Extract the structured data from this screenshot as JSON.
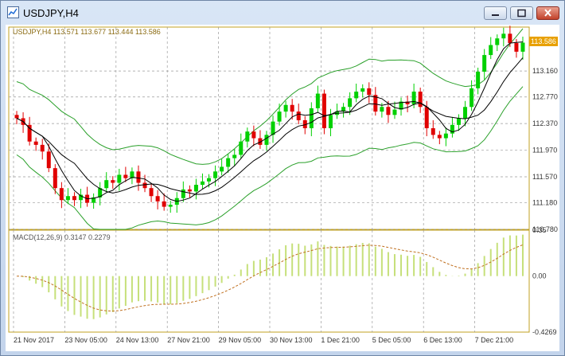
{
  "window": {
    "title": "USDJPY,H4"
  },
  "colors": {
    "bull": "#00d000",
    "bear": "#e00000",
    "grid": "#9a9a9a",
    "frame": "#c0a020",
    "bands": "#2aa02a",
    "ma": "#000000",
    "macd_hist": "#c6e07a",
    "macd_signal": "#c07020",
    "price_box": "#e8a000"
  },
  "chart_data": [
    {
      "type": "candlestick",
      "title": "USDJPY,H4",
      "ohlc_label": "USDJPY,H4  113.571 113.677 113.444 113.586",
      "current_price": "113.586",
      "ylim": [
        110.78,
        113.82
      ],
      "yticks": [
        "113.160",
        "112.770",
        "112.370",
        "111.970",
        "111.570",
        "111.180",
        "110.780"
      ],
      "xticks": [
        "21 Nov 2017",
        "23 Nov 05:00",
        "24 Nov 13:00",
        "27 Nov 21:00",
        "29 Nov 05:00",
        "30 Nov 13:00",
        "1 Dec 21:00",
        "5 Dec 05:00",
        "6 Dec 13:00",
        "7 Dec 21:00"
      ],
      "close": [
        112.45,
        112.35,
        112.1,
        112.05,
        111.95,
        111.7,
        111.4,
        111.22,
        111.28,
        111.22,
        111.3,
        111.18,
        111.26,
        111.4,
        111.52,
        111.48,
        111.6,
        111.55,
        111.65,
        111.48,
        111.4,
        111.28,
        111.2,
        111.12,
        111.15,
        111.25,
        111.38,
        111.35,
        111.45,
        111.5,
        111.55,
        111.65,
        111.72,
        111.85,
        111.9,
        112.1,
        112.25,
        112.15,
        112.05,
        112.2,
        112.4,
        112.55,
        112.65,
        112.55,
        112.42,
        112.3,
        112.6,
        112.82,
        112.3,
        112.5,
        112.55,
        112.62,
        112.75,
        112.85,
        112.9,
        112.8,
        112.55,
        112.62,
        112.5,
        112.58,
        112.7,
        112.66,
        112.85,
        112.62,
        112.3,
        112.2,
        112.15,
        112.22,
        112.35,
        112.45,
        112.62,
        112.9,
        113.15,
        113.4,
        113.55,
        113.65,
        113.72,
        113.58,
        113.45,
        113.586
      ],
      "bands": {
        "upper_start": 112.25,
        "upper_end": 113.92,
        "lower_start": 111.12,
        "lower_end": 111.78
      },
      "ma_periods": [
        5,
        10
      ]
    },
    {
      "type": "bar",
      "title": "MACD(12,26,9) 0.3147 0.2279",
      "ylim": [
        -0.4269,
        0.35
      ],
      "yticks": [
        "0.35",
        "0.00",
        "-0.4269"
      ],
      "series": [
        {
          "name": "MACD"
        },
        {
          "name": "Signal"
        }
      ]
    }
  ]
}
